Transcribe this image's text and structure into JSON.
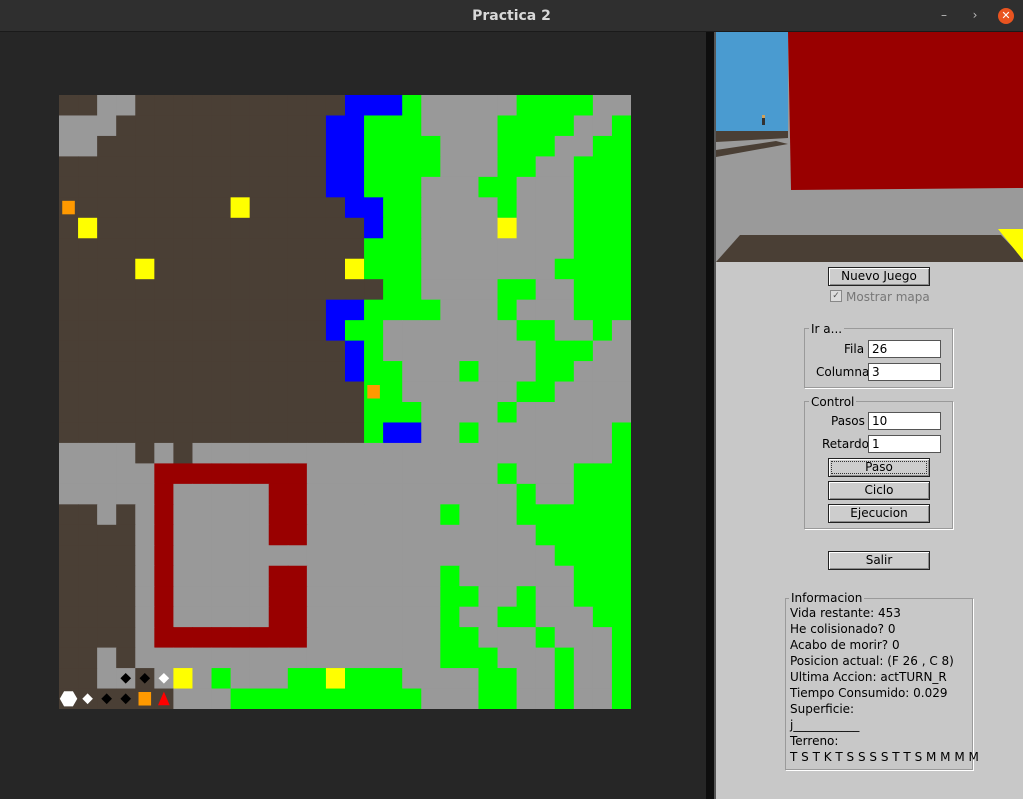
{
  "window": {
    "title": "Practica 2",
    "controls": [
      "minimize-icon",
      "restore-icon",
      "close-icon"
    ]
  },
  "colors": {
    "T": "#4a3f35",
    "S": "#999999",
    "B": "#00ff00",
    "A": "#0000ff",
    "M": "#990000",
    "K": "#ffff00",
    "O": "#ff9900",
    "sky": "#4a9bd0",
    "panel": "#c8c8c8"
  },
  "map": {
    "rows": [
      "TTSSTTTTTTTTTTTAAABSSSSSBBBBSS",
      "SSSTTTTTTTTTTTAABBBSSSSBBBBSSB",
      "SSTTTTTTTTTTTTAABBBBSSSBBBSSBB",
      "TTTTTTTTTTTTTTAABBBBSSSBBSSBBB",
      "TTTTTTTTTTTTTTAABBBSSSBBSSSBBB",
      "TTTTTTTTTTTTTTTAABBSSSSBSSSBBB",
      "TTTTTTTTTTTTTTTTABBSSSSSSSSBBB",
      "TTTTTTTTTTTTTTTTBBBSSSSSSSSBBB",
      "TTTTTTTTTTTTTTTTBBBSSSSSSSBBBB",
      "TTTTTTTTTTTTTTTTTBBSSSSBBSSBBB",
      "TTTTTTTTTTTTTTAABBBBSSSBSSSBBB",
      "TTTTTTTTTTTTTTABBSSSSSSSBBSSBS",
      "TTTTTTTTTTTTTTTABSSSSSSSSBBBSS",
      "TTTTTTTTTTTTTTTABBSSSBSSSBBSSS",
      "TTTTTTTTTTTTTTTTBBSSSSSSBBSSSS",
      "TTTTTTTTTTTTTTTTBBBSSSSBSSSSSS",
      "TTTTTTTTTTTTTTTTBAASSBSSSSSSSB",
      "SSSSTSTSSSSSSSSSSSSSSSSSSSSSSB",
      "SSSSSSSSSSSSSSSSSSSSSSSBSSSBBB",
      "SSSSSSSSSSSSSSSSSSSSSSSSBSSBBB",
      "TTSTSSSSSSSSSSSSSSSSBSSSBBBBBB",
      "TTTTSSSSSSSSSSSSSSSSSSSSSBBBBB",
      "TTTTSSSSSSSSSSSSSSSSSSSSSSBBBB",
      "TTTTSSSSSSSSSSSSSSSSBSSSSSSBBB",
      "TTTTSSSSSSSSSSSSSSSSBBSSBSSBBB",
      "TTTTSSSSSSSSSSSSSSSSBSSBBSSSBB",
      "TTTTSSSSSSSSSSSSSSSSBBSSSBSSSB",
      "TTSTSSSSSSSSSSSSSSSSBBBSSSBSSB",
      "TTSSTSSSBSSSBBBBBBSSSSBBSSBSSB",
      "TTTTTTSSSBBBBBBBBBBSSSBBSSBSSB"
    ],
    "wall": [
      [
        18,
        5
      ],
      [
        18,
        6
      ],
      [
        18,
        7
      ],
      [
        18,
        8
      ],
      [
        18,
        9
      ],
      [
        18,
        10
      ],
      [
        18,
        11
      ],
      [
        18,
        12
      ],
      [
        19,
        5
      ],
      [
        19,
        11
      ],
      [
        19,
        12
      ],
      [
        20,
        5
      ],
      [
        20,
        11
      ],
      [
        20,
        12
      ],
      [
        21,
        5
      ],
      [
        21,
        11
      ],
      [
        21,
        12
      ],
      [
        22,
        5
      ],
      [
        23,
        5
      ],
      [
        23,
        11
      ],
      [
        23,
        12
      ],
      [
        24,
        5
      ],
      [
        24,
        11
      ],
      [
        24,
        12
      ],
      [
        25,
        5
      ],
      [
        25,
        11
      ],
      [
        25,
        12
      ],
      [
        26,
        5
      ],
      [
        26,
        6
      ],
      [
        26,
        7
      ],
      [
        26,
        8
      ],
      [
        26,
        9
      ],
      [
        26,
        10
      ],
      [
        26,
        11
      ],
      [
        26,
        12
      ]
    ],
    "items": [
      {
        "r": 5,
        "c": 0,
        "t": "O"
      },
      {
        "r": 5,
        "c": 9,
        "t": "K"
      },
      {
        "r": 6,
        "c": 1,
        "t": "K"
      },
      {
        "r": 6,
        "c": 23,
        "t": "K"
      },
      {
        "r": 8,
        "c": 4,
        "t": "K"
      },
      {
        "r": 8,
        "c": 15,
        "t": "K"
      },
      {
        "r": 14,
        "c": 16,
        "t": "O"
      },
      {
        "r": 28,
        "c": 6,
        "t": "K"
      },
      {
        "r": 28,
        "c": 14,
        "t": "K"
      },
      {
        "r": 29,
        "c": 4,
        "t": "O"
      }
    ],
    "markers": [
      {
        "r": 28,
        "c": 3,
        "shape": "diamond",
        "color": "#000000"
      },
      {
        "r": 28,
        "c": 4,
        "shape": "diamond",
        "color": "#000000"
      },
      {
        "r": 28,
        "c": 5,
        "shape": "diamond",
        "color": "#ffffff"
      },
      {
        "r": 29,
        "c": 0,
        "shape": "hexagon",
        "color": "#ffffff"
      },
      {
        "r": 29,
        "c": 1,
        "shape": "diamond",
        "color": "#ffffff"
      },
      {
        "r": 29,
        "c": 2,
        "shape": "diamond",
        "color": "#000000"
      },
      {
        "r": 29,
        "c": 3,
        "shape": "diamond",
        "color": "#000000"
      },
      {
        "r": 29,
        "c": 5,
        "shape": "triangle",
        "color": "#ff0000"
      }
    ]
  },
  "controls": {
    "new_game": "Nuevo Juego",
    "show_map": "Mostrar mapa",
    "show_map_checked": true,
    "goto_title": "Ir a...",
    "row_label": "Fila",
    "row_value": "26",
    "col_label": "Columna",
    "col_value": "3",
    "control_title": "Control",
    "steps_label": "Pasos",
    "steps_value": "10",
    "delay_label": "Retardo",
    "delay_value": "1",
    "step_btn": "Paso",
    "cycle_btn": "Ciclo",
    "run_btn": "Ejecucion",
    "exit_btn": "Salir"
  },
  "info": {
    "title": "Informacion",
    "life": "Vida restante: 453",
    "collided": "He colisionado? 0",
    "died": "Acabo de morir? 0",
    "position": "Posicion actual: (F 26 , C 8)",
    "last_action": "Ultima Accion: actTURN_R",
    "time": "Tiempo Consumido: 0.029",
    "surface_label": "Superficie:",
    "surface_value": "j___________",
    "terrain_label": "Terreno:",
    "terrain_value": "T S T K T S S S S T T S M M M M"
  }
}
